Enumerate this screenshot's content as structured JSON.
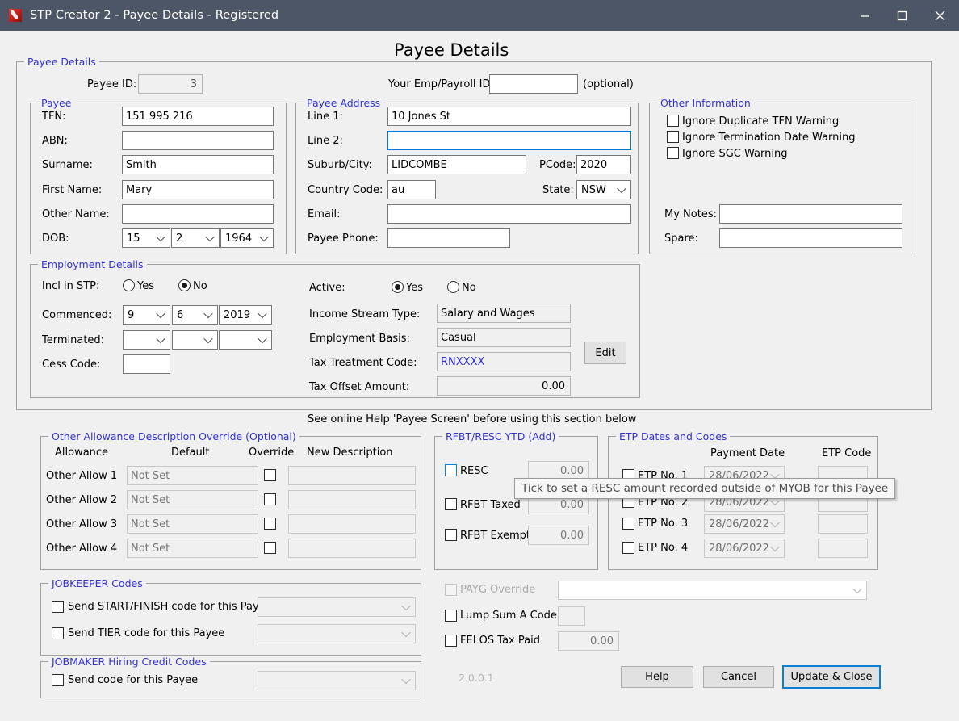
{
  "window": {
    "title": "STP Creator 2 - Payee Details - Registered",
    "app_icon": "app-cube-icon",
    "minimize": "–",
    "maximize": "□",
    "close": "✕",
    "titlebar_color": "#4d5666"
  },
  "page": {
    "heading": "Payee Details",
    "section_note": "See online Help 'Payee Screen' before using this section below",
    "version": "2.0.0.1",
    "group_caption_color": "#3333cc"
  },
  "payee_details": {
    "caption": "Payee Details",
    "payee_id_label": "Payee ID:",
    "payee_id_value": "3",
    "emp_payroll_label": "Your Emp/Payroll ID:",
    "emp_payroll_value": "",
    "optional_note": "(optional)"
  },
  "payee": {
    "caption": "Payee",
    "fields": [
      {
        "label": "TFN:",
        "value": "151 995 216"
      },
      {
        "label": "ABN:",
        "value": ""
      },
      {
        "label": "Surname:",
        "value": "Smith"
      },
      {
        "label": "First Name:",
        "value": "Mary"
      },
      {
        "label": "Other Name:",
        "value": ""
      }
    ],
    "dob_label": "DOB:",
    "dob_day": "15",
    "dob_month": "2",
    "dob_year": "1964"
  },
  "payee_address": {
    "caption": "Payee Address",
    "line1_label": "Line 1:",
    "line1_value": "10 Jones St",
    "line2_label": "Line 2:",
    "line2_value": "",
    "suburb_label": "Suburb/City:",
    "suburb_value": "LIDCOMBE",
    "pcode_label": "PCode:",
    "pcode_value": "2020",
    "country_label": "Country Code:",
    "country_value": "au",
    "state_label": "State:",
    "state_value": "NSW",
    "email_label": "Email:",
    "email_value": "",
    "phone_label": "Payee Phone:",
    "phone_value": ""
  },
  "other_information": {
    "caption": "Other Information",
    "checkboxes": [
      {
        "label": "Ignore Duplicate TFN Warning",
        "checked": false
      },
      {
        "label": "Ignore Termination Date Warning",
        "checked": false
      },
      {
        "label": "Ignore SGC Warning",
        "checked": false
      }
    ],
    "notes_label": "My Notes:",
    "notes_value": "",
    "spare_label": "Spare:",
    "spare_value": ""
  },
  "employment_details": {
    "caption": "Employment Details",
    "incl_stp_label": "Incl in STP:",
    "incl_stp_yes": "Yes",
    "incl_stp_no": "No",
    "incl_stp_selected": "No",
    "commenced_label": "Commenced:",
    "commenced_day": "9",
    "commenced_month": "6",
    "commenced_year": "2019",
    "terminated_label": "Terminated:",
    "terminated_day": "",
    "terminated_month": "",
    "terminated_year": "",
    "cess_code_label": "Cess Code:",
    "cess_code_value": "",
    "active_label": "Active:",
    "active_yes": "Yes",
    "active_no": "No",
    "active_selected": "Yes",
    "income_stream_label": "Income Stream Type:",
    "income_stream_value": "Salary and Wages",
    "employment_basis_label": "Employment Basis:",
    "employment_basis_value": "Casual",
    "tax_treatment_label": "Tax Treatment Code:",
    "tax_treatment_value": "RNXXXX",
    "tax_offset_label": "Tax Offset Amount:",
    "tax_offset_value": "0.00",
    "edit_button": "Edit"
  },
  "allowance_override": {
    "caption": "Other Allowance Description Override (Optional)",
    "columns": [
      "Allowance",
      "Default",
      "Override",
      "New Description"
    ],
    "rows": [
      {
        "name": "Other Allow 1",
        "default": "Not Set",
        "override": false,
        "description": ""
      },
      {
        "name": "Other Allow 2",
        "default": "Not Set",
        "override": false,
        "description": ""
      },
      {
        "name": "Other Allow 3",
        "default": "Not Set",
        "override": false,
        "description": ""
      },
      {
        "name": "Other Allow 4",
        "default": "Not Set",
        "override": false,
        "description": ""
      }
    ]
  },
  "rfbt_resc": {
    "caption": "RFBT/RESC YTD (Add)",
    "rows": [
      {
        "label": "RESC",
        "checked": false,
        "focused": true,
        "amount": "0.00"
      },
      {
        "label": "RFBT Taxed",
        "checked": false,
        "focused": false,
        "amount": "0.00"
      },
      {
        "label": "RFBT Exempt",
        "checked": false,
        "focused": false,
        "amount": "0.00"
      }
    ]
  },
  "etp": {
    "caption": "ETP Dates and Codes",
    "col_payment_date": "Payment Date",
    "col_etp_code": "ETP Code",
    "rows": [
      {
        "label": "ETP No. 1",
        "checked": false,
        "date": "28/06/2022",
        "code": ""
      },
      {
        "label": "ETP No. 2",
        "checked": false,
        "date": "28/06/2022",
        "code": ""
      },
      {
        "label": "ETP No. 3",
        "checked": false,
        "date": "28/06/2022",
        "code": ""
      },
      {
        "label": "ETP No. 4",
        "checked": false,
        "date": "28/06/2022",
        "code": ""
      }
    ]
  },
  "jobkeeper": {
    "caption": "JOBKEEPER Codes",
    "rows": [
      {
        "label": "Send START/FINISH code for this Payee",
        "checked": false,
        "value": ""
      },
      {
        "label": "Send TIER code for this Payee",
        "checked": false,
        "value": ""
      }
    ]
  },
  "jobmaker": {
    "caption": "JOBMAKER Hiring Credit Codes",
    "rows": [
      {
        "label": "Send code for this Payee",
        "checked": false,
        "value": ""
      }
    ]
  },
  "misc": {
    "payg_override_label": "PAYG Override",
    "payg_override_value": "",
    "payg_override_disabled": true,
    "lump_sum_label": "Lump Sum A Code",
    "lump_sum_value": "",
    "fei_label": "FEI OS Tax Paid",
    "fei_value": "0.00"
  },
  "buttons": {
    "help": "Help",
    "cancel": "Cancel",
    "update_close": "Update & Close"
  },
  "tooltip": {
    "text": "Tick to set a RESC amount recorded outside of MYOB for this Payee"
  }
}
